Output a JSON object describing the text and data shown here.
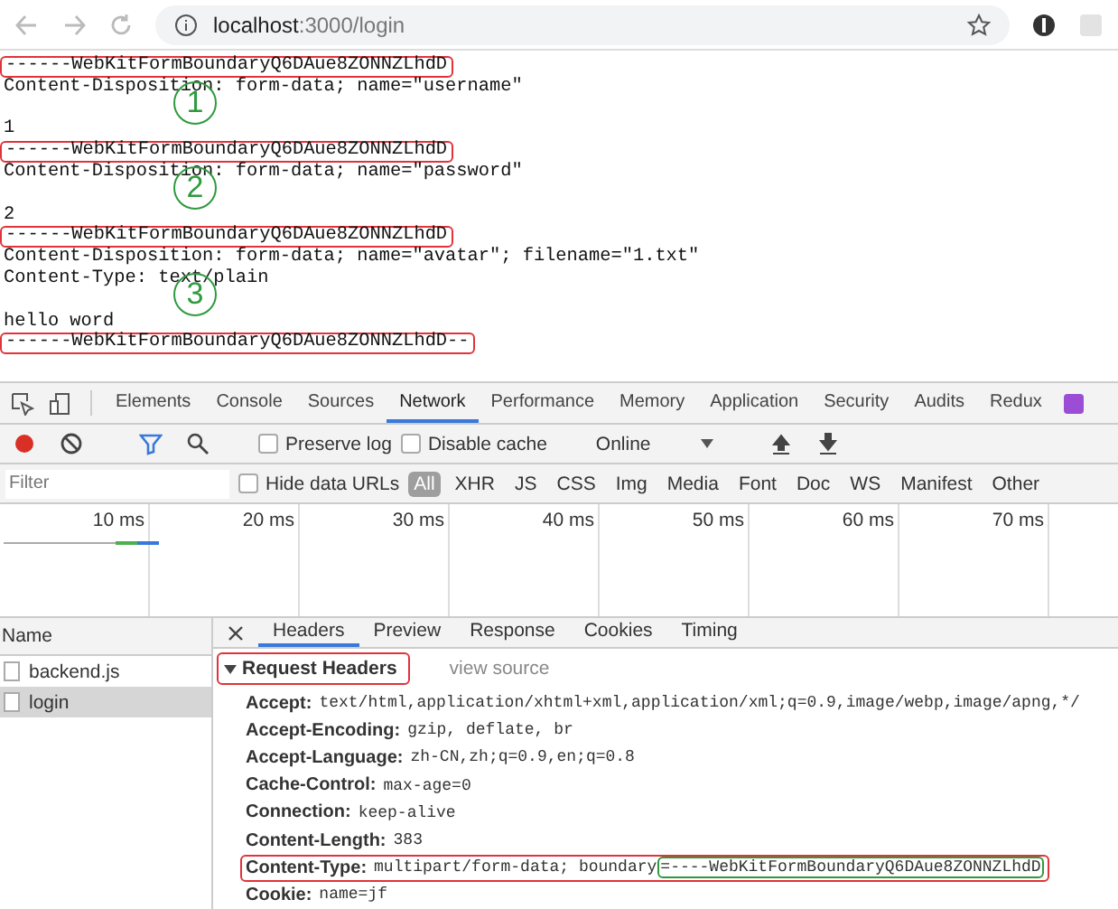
{
  "browser": {
    "address_host": "localhost",
    "address_rest": ":3000/login"
  },
  "body": {
    "parts": [
      {
        "boundary": "------WebKitFormBoundaryQ6DAue8ZONNZLhdD",
        "outlined": true,
        "headers": [
          "Content-Disposition: form-data; name=\"username\""
        ],
        "value": "1",
        "marker": "1"
      },
      {
        "boundary": "------WebKitFormBoundaryQ6DAue8ZONNZLhdD",
        "outlined": true,
        "headers": [
          "Content-Disposition: form-data; name=\"password\""
        ],
        "value": "2",
        "marker": "2"
      },
      {
        "boundary": "------WebKitFormBoundaryQ6DAue8ZONNZLhdD",
        "outlined": true,
        "headers": [
          "Content-Disposition: form-data; name=\"avatar\"; filename=\"1.txt\"",
          "Content-Type: text/plain"
        ],
        "value": "hello word",
        "marker": "3"
      }
    ],
    "closing": {
      "boundary": "------WebKitFormBoundaryQ6DAue8ZONNZLhdD--",
      "outlined": true
    }
  },
  "devtools": {
    "tabs": [
      {
        "label": "Elements",
        "selected": false
      },
      {
        "label": "Console",
        "selected": false
      },
      {
        "label": "Sources",
        "selected": false
      },
      {
        "label": "Network",
        "selected": true
      },
      {
        "label": "Performance",
        "selected": false
      },
      {
        "label": "Memory",
        "selected": false
      },
      {
        "label": "Application",
        "selected": false
      },
      {
        "label": "Security",
        "selected": false
      },
      {
        "label": "Audits",
        "selected": false
      },
      {
        "label": "Redux",
        "selected": false
      }
    ],
    "toolbar": {
      "recording": true,
      "filter_active": true,
      "checkboxes": [
        {
          "label": "Preserve log",
          "checked": false
        },
        {
          "label": "Disable cache",
          "checked": false
        }
      ],
      "throttle": "Online"
    },
    "filter": {
      "placeholder": "Filter",
      "hide_data_urls": {
        "label": "Hide data URLs",
        "checked": false
      },
      "types": [
        {
          "label": "All",
          "selected": true
        },
        {
          "label": "XHR",
          "selected": false
        },
        {
          "label": "JS",
          "selected": false
        },
        {
          "label": "CSS",
          "selected": false
        },
        {
          "label": "Img",
          "selected": false
        },
        {
          "label": "Media",
          "selected": false
        },
        {
          "label": "Font",
          "selected": false
        },
        {
          "label": "Doc",
          "selected": false
        },
        {
          "label": "WS",
          "selected": false
        },
        {
          "label": "Manifest",
          "selected": false
        },
        {
          "label": "Other",
          "selected": false
        }
      ]
    },
    "timeline": {
      "ticks": [
        "10 ms",
        "20 ms",
        "30 ms",
        "40 ms",
        "50 ms",
        "60 ms",
        "70 ms"
      ]
    },
    "requests": {
      "column": "Name",
      "items": [
        {
          "name": "backend.js",
          "selected": false
        },
        {
          "name": "login",
          "selected": true
        }
      ]
    },
    "detail": {
      "tabs": [
        {
          "label": "Headers",
          "selected": true
        },
        {
          "label": "Preview",
          "selected": false
        },
        {
          "label": "Response",
          "selected": false
        },
        {
          "label": "Cookies",
          "selected": false
        },
        {
          "label": "Timing",
          "selected": false
        }
      ],
      "section": {
        "title": "Request Headers",
        "expanded": true,
        "outlined": true,
        "link": "view source"
      },
      "headers": [
        {
          "name": "Accept:",
          "value": "text/html,application/xhtml+xml,application/xml;q=0.9,image/webp,image/apng,*/",
          "outlined": false
        },
        {
          "name": "Accept-Encoding:",
          "value": "gzip, deflate, br",
          "outlined": false
        },
        {
          "name": "Accept-Language:",
          "value": "zh-CN,zh;q=0.9,en;q=0.8",
          "outlined": false
        },
        {
          "name": "Cache-Control:",
          "value": "max-age=0",
          "outlined": false
        },
        {
          "name": "Connection:",
          "value": "keep-alive",
          "outlined": false
        },
        {
          "name": "Content-Length:",
          "value": "383",
          "outlined": false
        },
        {
          "name": "Content-Type:",
          "value": "multipart/form-data; boundary",
          "highlight": "=----WebKitFormBoundaryQ6DAue8ZONNZLhdD",
          "outlined": true
        },
        {
          "name": "Cookie:",
          "value": "name=jf",
          "outlined": false
        }
      ]
    }
  }
}
